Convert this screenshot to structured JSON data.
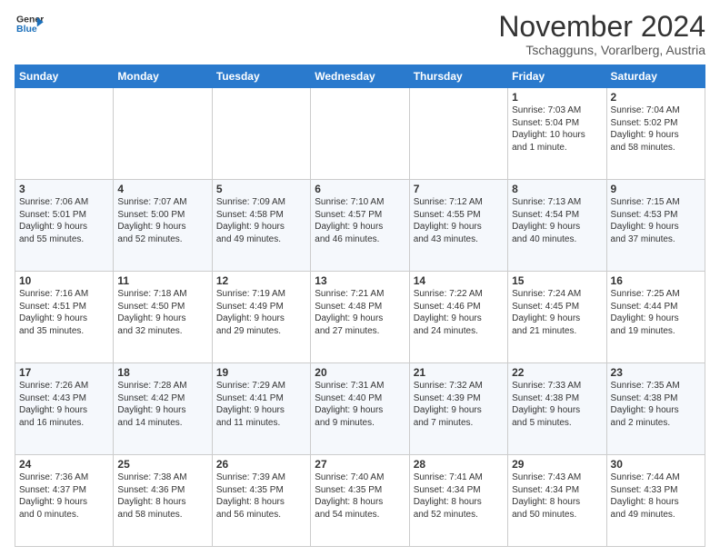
{
  "logo": {
    "line1": "General",
    "line2": "Blue"
  },
  "title": "November 2024",
  "location": "Tschagguns, Vorarlberg, Austria",
  "days_header": [
    "Sunday",
    "Monday",
    "Tuesday",
    "Wednesday",
    "Thursday",
    "Friday",
    "Saturday"
  ],
  "weeks": [
    [
      {
        "day": "",
        "info": ""
      },
      {
        "day": "",
        "info": ""
      },
      {
        "day": "",
        "info": ""
      },
      {
        "day": "",
        "info": ""
      },
      {
        "day": "",
        "info": ""
      },
      {
        "day": "1",
        "info": "Sunrise: 7:03 AM\nSunset: 5:04 PM\nDaylight: 10 hours\nand 1 minute."
      },
      {
        "day": "2",
        "info": "Sunrise: 7:04 AM\nSunset: 5:02 PM\nDaylight: 9 hours\nand 58 minutes."
      }
    ],
    [
      {
        "day": "3",
        "info": "Sunrise: 7:06 AM\nSunset: 5:01 PM\nDaylight: 9 hours\nand 55 minutes."
      },
      {
        "day": "4",
        "info": "Sunrise: 7:07 AM\nSunset: 5:00 PM\nDaylight: 9 hours\nand 52 minutes."
      },
      {
        "day": "5",
        "info": "Sunrise: 7:09 AM\nSunset: 4:58 PM\nDaylight: 9 hours\nand 49 minutes."
      },
      {
        "day": "6",
        "info": "Sunrise: 7:10 AM\nSunset: 4:57 PM\nDaylight: 9 hours\nand 46 minutes."
      },
      {
        "day": "7",
        "info": "Sunrise: 7:12 AM\nSunset: 4:55 PM\nDaylight: 9 hours\nand 43 minutes."
      },
      {
        "day": "8",
        "info": "Sunrise: 7:13 AM\nSunset: 4:54 PM\nDaylight: 9 hours\nand 40 minutes."
      },
      {
        "day": "9",
        "info": "Sunrise: 7:15 AM\nSunset: 4:53 PM\nDaylight: 9 hours\nand 37 minutes."
      }
    ],
    [
      {
        "day": "10",
        "info": "Sunrise: 7:16 AM\nSunset: 4:51 PM\nDaylight: 9 hours\nand 35 minutes."
      },
      {
        "day": "11",
        "info": "Sunrise: 7:18 AM\nSunset: 4:50 PM\nDaylight: 9 hours\nand 32 minutes."
      },
      {
        "day": "12",
        "info": "Sunrise: 7:19 AM\nSunset: 4:49 PM\nDaylight: 9 hours\nand 29 minutes."
      },
      {
        "day": "13",
        "info": "Sunrise: 7:21 AM\nSunset: 4:48 PM\nDaylight: 9 hours\nand 27 minutes."
      },
      {
        "day": "14",
        "info": "Sunrise: 7:22 AM\nSunset: 4:46 PM\nDaylight: 9 hours\nand 24 minutes."
      },
      {
        "day": "15",
        "info": "Sunrise: 7:24 AM\nSunset: 4:45 PM\nDaylight: 9 hours\nand 21 minutes."
      },
      {
        "day": "16",
        "info": "Sunrise: 7:25 AM\nSunset: 4:44 PM\nDaylight: 9 hours\nand 19 minutes."
      }
    ],
    [
      {
        "day": "17",
        "info": "Sunrise: 7:26 AM\nSunset: 4:43 PM\nDaylight: 9 hours\nand 16 minutes."
      },
      {
        "day": "18",
        "info": "Sunrise: 7:28 AM\nSunset: 4:42 PM\nDaylight: 9 hours\nand 14 minutes."
      },
      {
        "day": "19",
        "info": "Sunrise: 7:29 AM\nSunset: 4:41 PM\nDaylight: 9 hours\nand 11 minutes."
      },
      {
        "day": "20",
        "info": "Sunrise: 7:31 AM\nSunset: 4:40 PM\nDaylight: 9 hours\nand 9 minutes."
      },
      {
        "day": "21",
        "info": "Sunrise: 7:32 AM\nSunset: 4:39 PM\nDaylight: 9 hours\nand 7 minutes."
      },
      {
        "day": "22",
        "info": "Sunrise: 7:33 AM\nSunset: 4:38 PM\nDaylight: 9 hours\nand 5 minutes."
      },
      {
        "day": "23",
        "info": "Sunrise: 7:35 AM\nSunset: 4:38 PM\nDaylight: 9 hours\nand 2 minutes."
      }
    ],
    [
      {
        "day": "24",
        "info": "Sunrise: 7:36 AM\nSunset: 4:37 PM\nDaylight: 9 hours\nand 0 minutes."
      },
      {
        "day": "25",
        "info": "Sunrise: 7:38 AM\nSunset: 4:36 PM\nDaylight: 8 hours\nand 58 minutes."
      },
      {
        "day": "26",
        "info": "Sunrise: 7:39 AM\nSunset: 4:35 PM\nDaylight: 8 hours\nand 56 minutes."
      },
      {
        "day": "27",
        "info": "Sunrise: 7:40 AM\nSunset: 4:35 PM\nDaylight: 8 hours\nand 54 minutes."
      },
      {
        "day": "28",
        "info": "Sunrise: 7:41 AM\nSunset: 4:34 PM\nDaylight: 8 hours\nand 52 minutes."
      },
      {
        "day": "29",
        "info": "Sunrise: 7:43 AM\nSunset: 4:34 PM\nDaylight: 8 hours\nand 50 minutes."
      },
      {
        "day": "30",
        "info": "Sunrise: 7:44 AM\nSunset: 4:33 PM\nDaylight: 8 hours\nand 49 minutes."
      }
    ]
  ]
}
